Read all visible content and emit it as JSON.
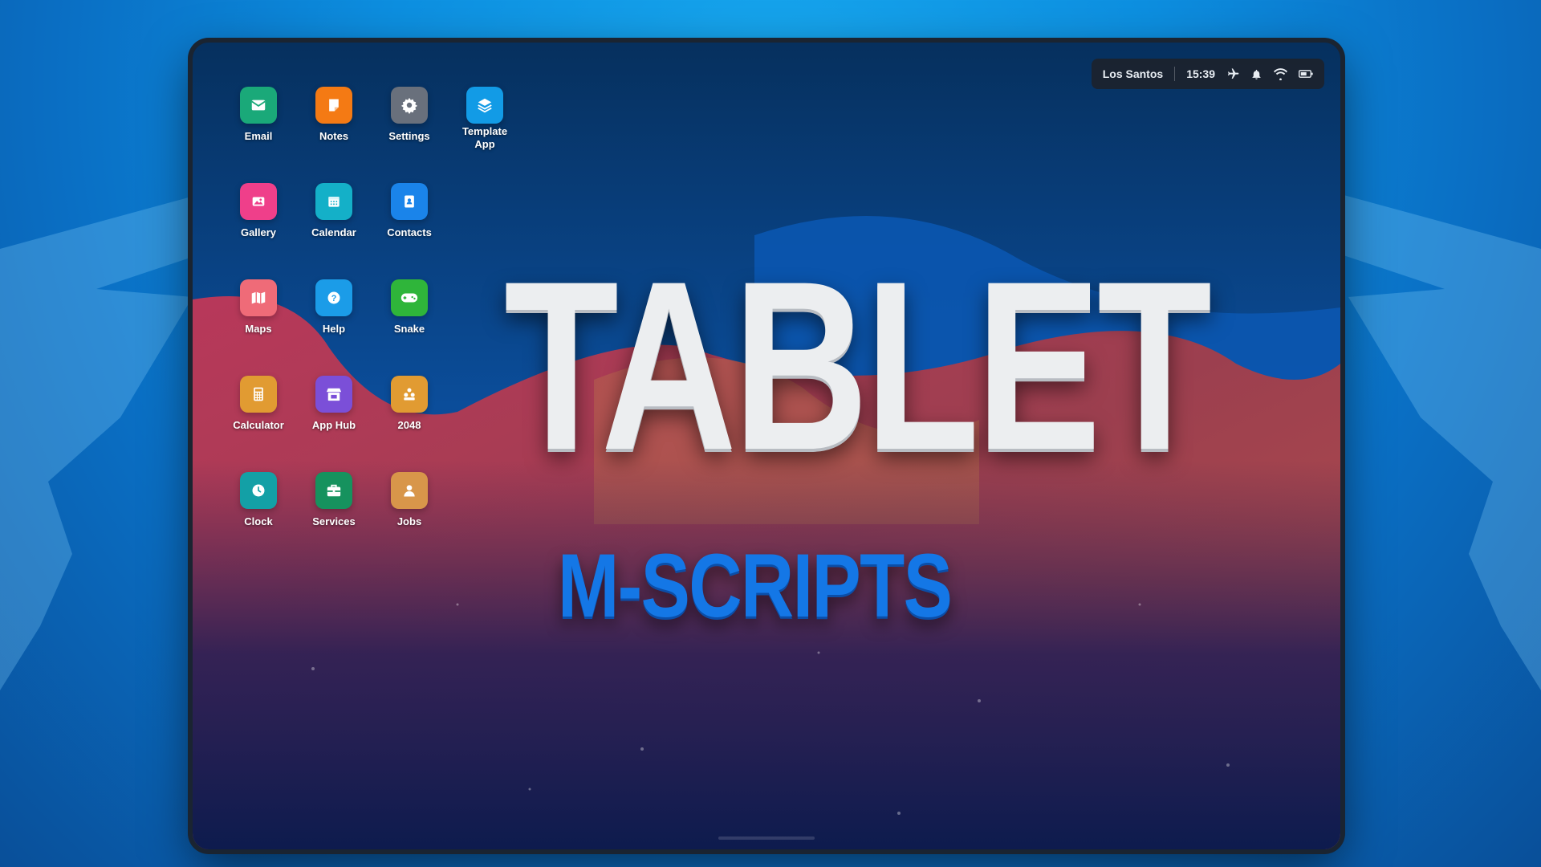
{
  "status": {
    "location": "Los Santos",
    "time": "15:39",
    "icons": [
      "airplane-icon",
      "bell-icon",
      "wifi-icon",
      "battery-icon"
    ]
  },
  "apps": [
    {
      "label": "Email",
      "icon": "mail-icon",
      "color": "#1aa979"
    },
    {
      "label": "Notes",
      "icon": "note-icon",
      "color": "#f47a14"
    },
    {
      "label": "Settings",
      "icon": "gear-icon",
      "color": "#69707c"
    },
    {
      "label": "Template App",
      "icon": "layers-icon",
      "color": "#129be6"
    },
    {
      "label": "Gallery",
      "icon": "image-icon",
      "color": "#ef3f8a"
    },
    {
      "label": "Calendar",
      "icon": "calendar-icon",
      "color": "#14b0c8"
    },
    {
      "label": "Contacts",
      "icon": "contact-book-icon",
      "color": "#1a84ea"
    },
    {
      "label": "Maps",
      "icon": "map-icon",
      "color": "#ef6b78"
    },
    {
      "label": "Help",
      "icon": "question-icon",
      "color": "#1b9ce8"
    },
    {
      "label": "Snake",
      "icon": "gamepad-icon",
      "color": "#2fb53a"
    },
    {
      "label": "Calculator",
      "icon": "calculator-icon",
      "color": "#e19b32"
    },
    {
      "label": "App Hub",
      "icon": "store-icon",
      "color": "#7b4fd8"
    },
    {
      "label": "2048",
      "icon": "blocks-icon",
      "color": "#e19b32"
    },
    {
      "label": "Clock",
      "icon": "clock-icon",
      "color": "#13a0a6"
    },
    {
      "label": "Services",
      "icon": "briefcase-icon",
      "color": "#16925e"
    },
    {
      "label": "Jobs",
      "icon": "person-icon",
      "color": "#d8964a"
    }
  ],
  "title": "TABLET",
  "subtitle": "M-SCRIPTS"
}
